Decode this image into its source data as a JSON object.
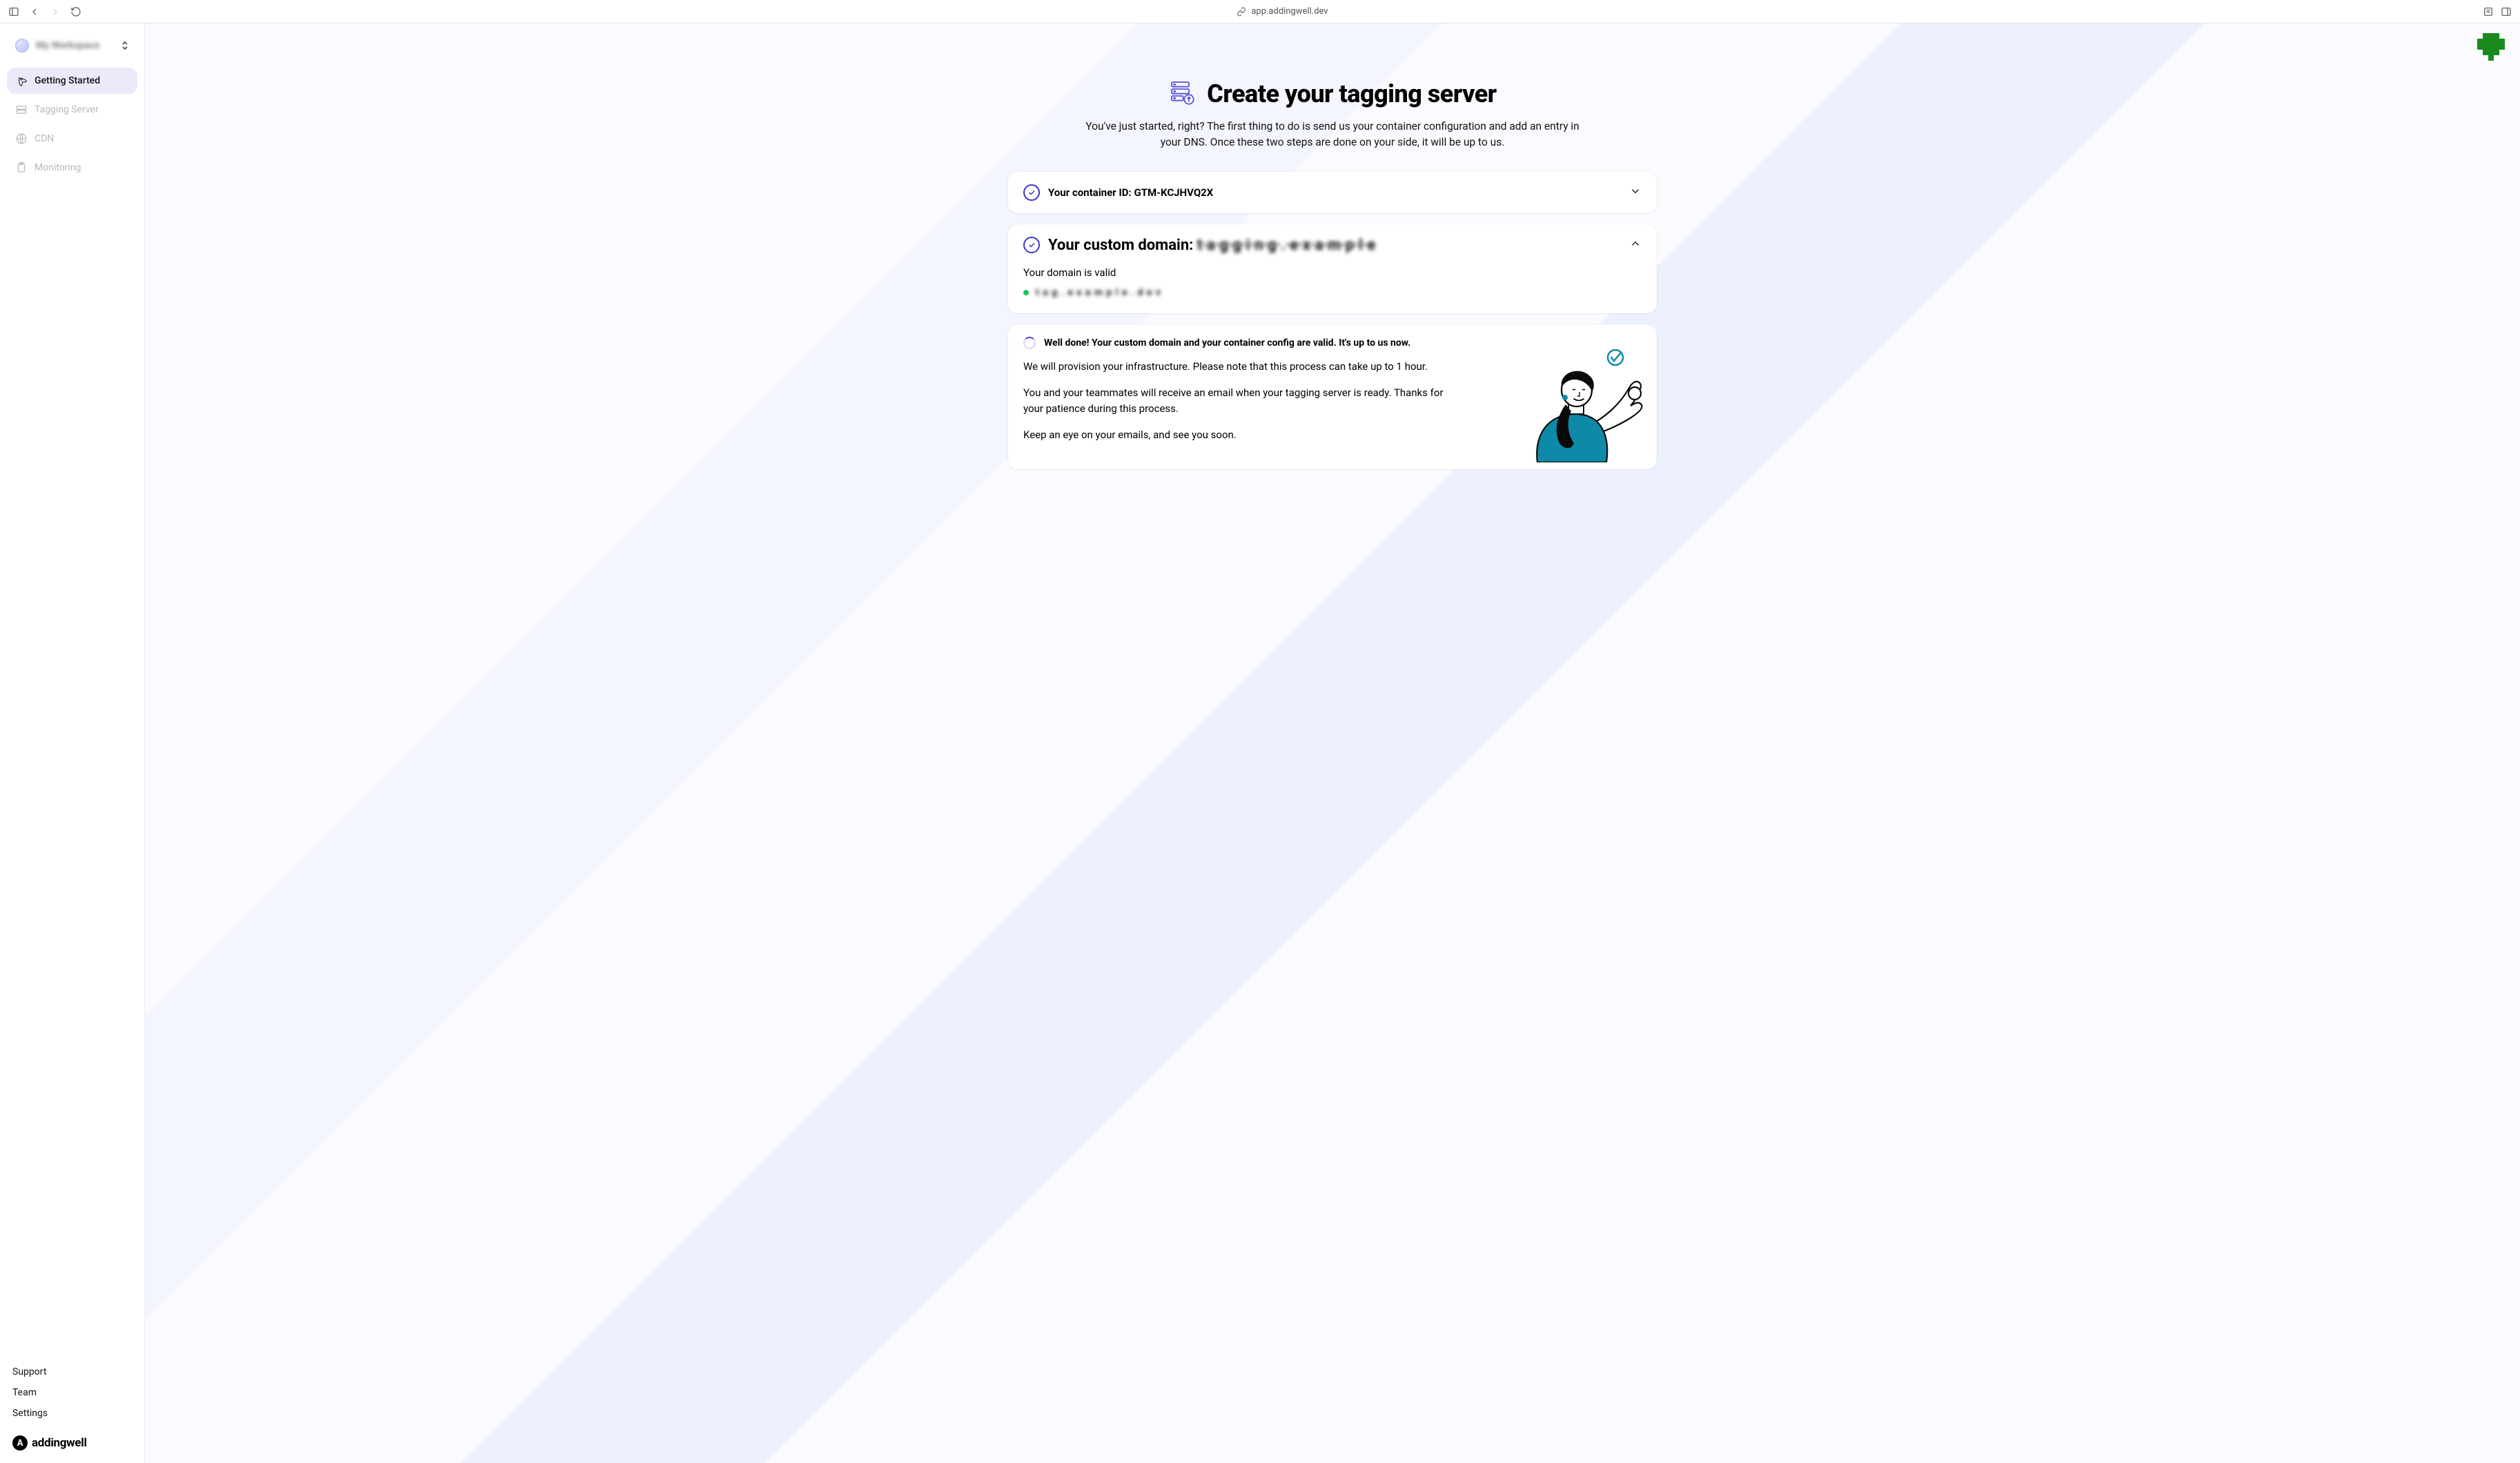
{
  "browser": {
    "url": "app.addingwell.dev"
  },
  "workspace": {
    "name": "My Workspace"
  },
  "sidebar": {
    "items": [
      {
        "label": "Getting Started"
      },
      {
        "label": "Tagging Server"
      },
      {
        "label": "CDN"
      },
      {
        "label": "Monitoring"
      }
    ],
    "footer": {
      "support": "Support",
      "team": "Team",
      "settings": "Settings"
    },
    "brand": "addingwell"
  },
  "page": {
    "title": "Create your tagging server",
    "subtitle": "You've just started, right? The first thing to do is send us your container configuration and add an entry in your DNS. Once these two steps are done on your side, it will be up to us."
  },
  "sections": {
    "container": {
      "label_prefix": "Your container ID: ",
      "value": "GTM-KCJHVQ2X"
    },
    "domain": {
      "label_prefix": "Your custom domain: ",
      "value_masked": "t·a·g·g·i·n·g·.·e·x·a·m·p·l·e",
      "valid_text": "Your domain is valid",
      "domain_masked": "t a g . e x a m p l e . d e v"
    },
    "done": {
      "heading": "Well done! Your custom domain and your container config are valid. It's up to us now.",
      "p1": "We will provision your infrastructure. Please note that this process can take up to 1 hour.",
      "p2": "You and your teammates will receive an email when your tagging server is ready. Thanks for your patience during this process.",
      "p3": "Keep an eye on your emails, and see you soon."
    }
  }
}
